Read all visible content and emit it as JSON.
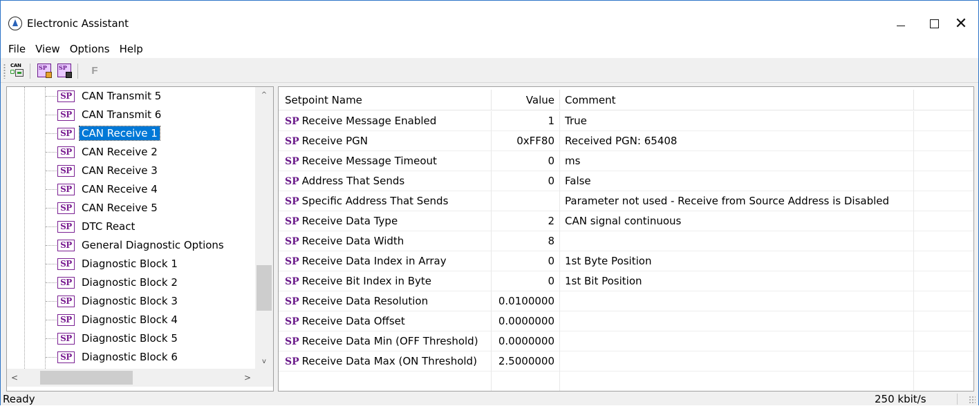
{
  "window": {
    "title": "Electronic Assistant",
    "controls": {
      "minimize": "—",
      "maximize": "",
      "close": "✕"
    }
  },
  "menu": [
    "File",
    "View",
    "Options",
    "Help"
  ],
  "toolbar": {
    "can_icon_text": "CAN",
    "sp_icon_text": "SP",
    "f_label": "F"
  },
  "tree": {
    "badge": "SP",
    "selected_index": 2,
    "items": [
      "CAN Transmit 5",
      "CAN Transmit 6",
      "CAN Receive 1",
      "CAN Receive 2",
      "CAN Receive 3",
      "CAN Receive 4",
      "CAN Receive 5",
      "DTC React",
      "General Diagnostic Options",
      "Diagnostic Block 1",
      "Diagnostic Block 2",
      "Diagnostic Block 3",
      "Diagnostic Block 4",
      "Diagnostic Block 5",
      "Diagnostic Block 6"
    ],
    "scroll": {
      "up": "^",
      "down": "v",
      "left": "<",
      "right": ">"
    }
  },
  "grid": {
    "headers": {
      "name": "Setpoint Name",
      "value": "Value",
      "comment": "Comment"
    },
    "sp_mark": "SP",
    "rows": [
      {
        "name": "Receive Message Enabled",
        "value": "1",
        "comment": "True"
      },
      {
        "name": "Receive PGN",
        "value": "0xFF80",
        "comment": "Received PGN: 65408"
      },
      {
        "name": "Receive Message Timeout",
        "value": "0",
        "comment": "ms"
      },
      {
        "name": "Address That Sends",
        "value": "0",
        "comment": "False"
      },
      {
        "name": "Specific Address That Sends",
        "value": "",
        "comment": "Parameter not used - Receive from Source Address is Disabled"
      },
      {
        "name": "Receive Data Type",
        "value": "2",
        "comment": "CAN signal continuous"
      },
      {
        "name": "Receive Data Width",
        "value": "8",
        "comment": ""
      },
      {
        "name": "Receive Data Index in Array",
        "value": "0",
        "comment": "1st Byte Position"
      },
      {
        "name": "Receive Bit Index in Byte",
        "value": "0",
        "comment": "1st Bit Position"
      },
      {
        "name": "Receive Data Resolution",
        "value": "0.0100000",
        "comment": ""
      },
      {
        "name": "Receive Data Offset",
        "value": "0.0000000",
        "comment": ""
      },
      {
        "name": "Receive Data Min (OFF Threshold)",
        "value": "0.0000000",
        "comment": ""
      },
      {
        "name": "Receive Data Max (ON Threshold)",
        "value": "2.5000000",
        "comment": ""
      }
    ]
  },
  "status": {
    "left": "Ready",
    "right": "250 kbit/s"
  }
}
